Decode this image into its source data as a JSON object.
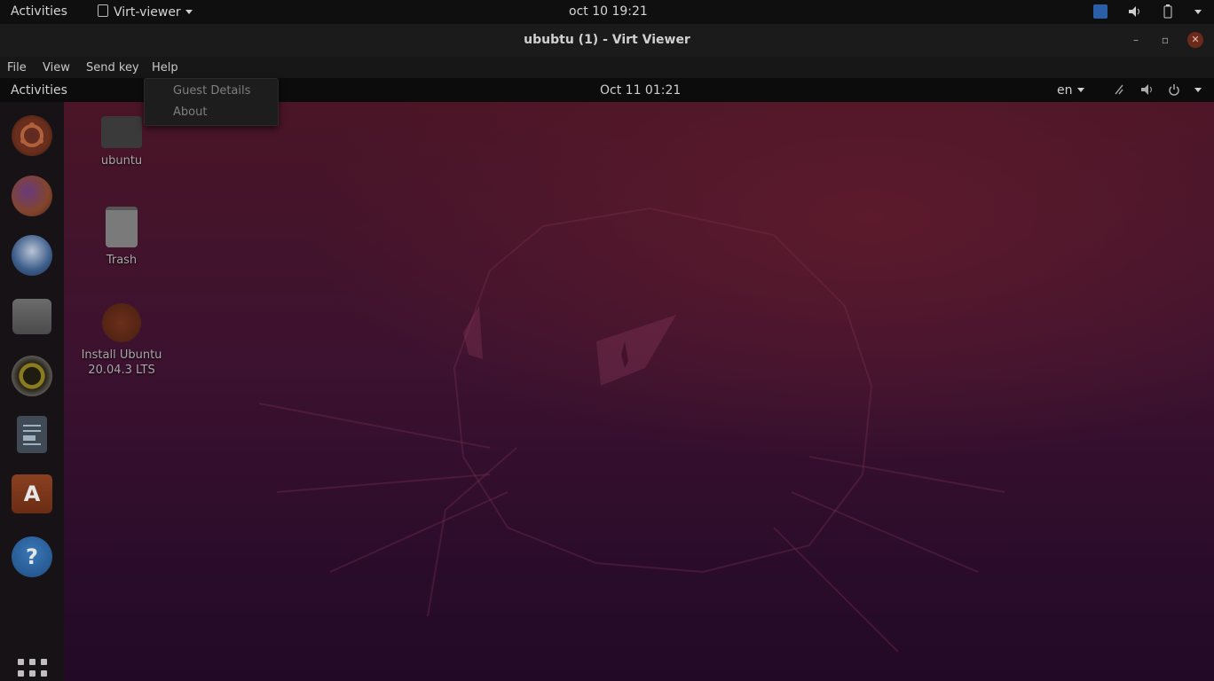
{
  "host_bar": {
    "activities": "Activities",
    "app_name": "Virt-viewer",
    "clock": "oct 10  19:21"
  },
  "window": {
    "title": "ububtu (1) - Virt Viewer",
    "minimize": "–",
    "maximize": "▫",
    "close": "✕"
  },
  "menubar": {
    "items": [
      "File",
      "View",
      "Send key",
      "Help"
    ]
  },
  "help_menu": {
    "items": [
      "Guest Details",
      "About"
    ]
  },
  "guest_bar": {
    "activities": "Activities",
    "clock": "Oct 11  01:21",
    "language": "en"
  },
  "desktop_icons": [
    {
      "label": "ubuntu"
    },
    {
      "label": "Trash"
    },
    {
      "label": "Install Ubuntu\n20.04.3 LTS"
    }
  ],
  "dock": {
    "apps": [
      "ubuntu-icon",
      "firefox-icon",
      "thunderbird-icon",
      "files-icon",
      "rhythmbox-icon",
      "writer-icon",
      "software-icon",
      "help-icon"
    ],
    "help_glyph": "?",
    "software_glyph": "A"
  }
}
